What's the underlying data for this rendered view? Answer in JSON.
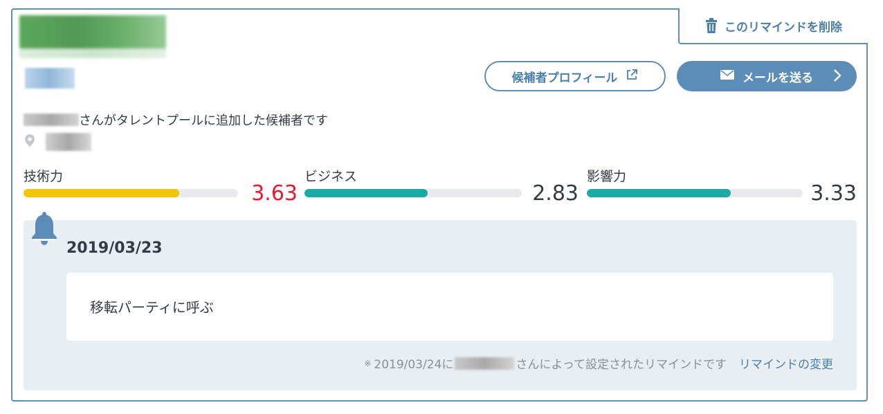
{
  "card": {
    "delete_label": "このリマインドを削除",
    "profile_button_label": "候補者プロフィール",
    "mail_button_label": "メールを送る",
    "added_text": "さんがタレントプールに追加した候補者です"
  },
  "skills": [
    {
      "label": "技術力",
      "score": "3.63",
      "level": 0.726,
      "color": "#f5c400",
      "score_color": "#e8192c"
    },
    {
      "label": "ビジネス",
      "score": "2.83",
      "level": 0.566,
      "color": "#1aaba4",
      "score_color": "#333b45"
    },
    {
      "label": "影響力",
      "score": "3.33",
      "level": 0.666,
      "color": "#1aaba4",
      "score_color": "#333b45"
    }
  ],
  "reminder": {
    "date": "2019/03/23",
    "body": "移転パーティに呼ぶ",
    "footer_mark": "※",
    "footer_prefix": "2019/03/24に",
    "footer_suffix": "さんによって設定されたリマインドです",
    "change_link": "リマインドの変更"
  },
  "colors": {
    "accent": "#5b8db8",
    "panel": "#e9eef2"
  }
}
